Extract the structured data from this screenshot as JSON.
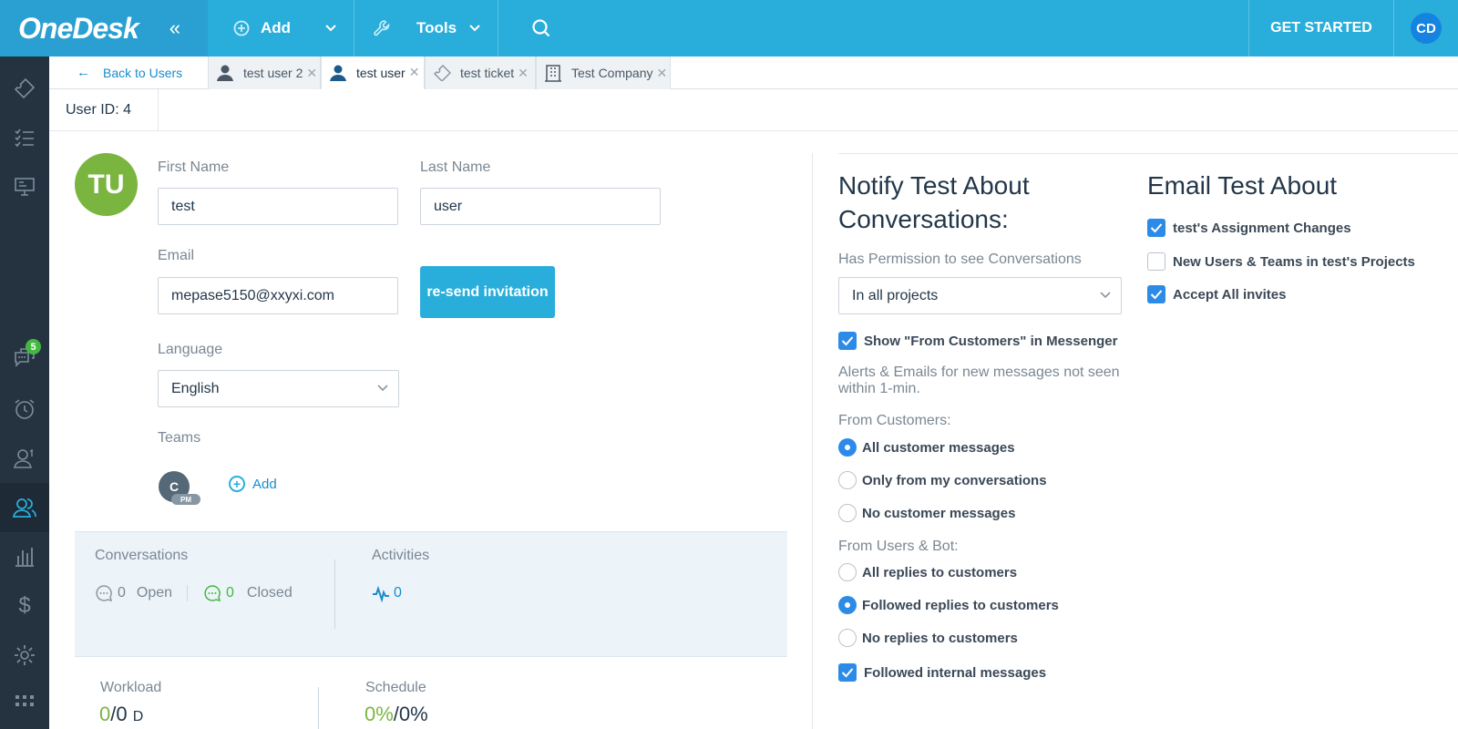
{
  "topbar": {
    "logo": "OneDesk",
    "add_label": "Add",
    "tools_label": "Tools",
    "get_started": "GET STARTED",
    "user_initials": "CD"
  },
  "sidebar": {
    "badge_count": "5",
    "icons": [
      "ticket-icon",
      "tasks-icon",
      "board-icon",
      "messenger-icon",
      "timer-icon",
      "customers-icon",
      "users-icon",
      "reports-icon",
      "billing-icon",
      "settings-icon",
      "apps-icon"
    ]
  },
  "tabs": {
    "back_label": "Back to Users",
    "items": [
      {
        "label": "test user 2"
      },
      {
        "label": "test user"
      },
      {
        "label": "test ticket"
      },
      {
        "label": "Test Company"
      }
    ]
  },
  "user_id": "User ID: 4",
  "profile": {
    "initials": "TU",
    "first_name_label": "First Name",
    "first_name": "test",
    "last_name_label": "Last Name",
    "last_name": "user",
    "email_label": "Email",
    "email": "mepase5150@xxyxi.com",
    "resend_label": "re-send invitation",
    "language_label": "Language",
    "language": "English",
    "teams_label": "Teams",
    "team_initial": "C",
    "team_role": "PM",
    "add_team_label": "Add"
  },
  "stats": {
    "conversations_label": "Conversations",
    "open_count": "0",
    "open_label": "Open",
    "closed_count": "0",
    "closed_label": "Closed",
    "activities_label": "Activities",
    "activities_count": "0",
    "workload_label": "Workload",
    "workload_done": "0",
    "workload_sep": "/",
    "workload_total": "0",
    "workload_unit": "D",
    "schedule_label": "Schedule",
    "schedule_done": "0%",
    "schedule_sep": "/",
    "schedule_total": "0%"
  },
  "notify": {
    "title_line1": "Notify Test About",
    "title_line2": "Conversations:",
    "permission_label": "Has Permission to see Conversations",
    "permission_value": "In all projects",
    "show_from_customers": "Show \"From Customers\" in Messenger",
    "alerts_line1": "Alerts & Emails for new messages not seen",
    "alerts_line2": "within 1-min.",
    "from_customers_label": "From Customers:",
    "customer_options": [
      {
        "label": "All customer messages",
        "selected": true
      },
      {
        "label": "Only from my conversations",
        "selected": false
      },
      {
        "label": "No customer messages",
        "selected": false
      }
    ],
    "from_users_label": "From Users & Bot:",
    "user_options": [
      {
        "label": "All replies to customers",
        "selected": false
      },
      {
        "label": "Followed replies to customers",
        "selected": true
      },
      {
        "label": "No replies to customers",
        "selected": false
      }
    ],
    "followed_internal": "Followed internal messages"
  },
  "email_about": {
    "title": "Email Test About",
    "options": [
      {
        "label": "test's Assignment Changes",
        "checked": true
      },
      {
        "label": "New Users & Teams in test's Projects",
        "checked": false
      },
      {
        "label": "Accept All invites",
        "checked": true
      }
    ]
  },
  "colors": {
    "topbar": "#29aedb",
    "sidebar": "#253341",
    "accent": "#2d8be8",
    "green": "#43b840"
  }
}
